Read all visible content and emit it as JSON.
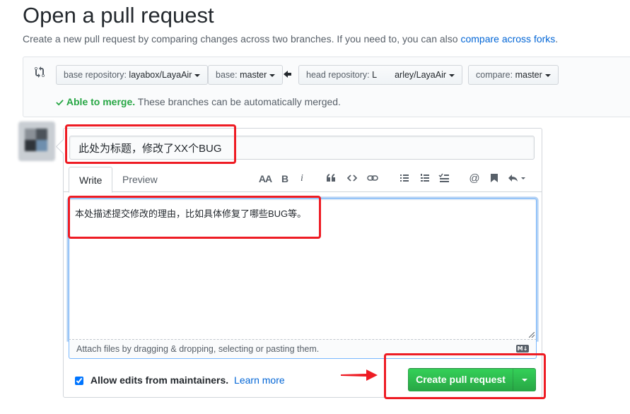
{
  "page": {
    "title": "Open a pull request",
    "subtitle": "Create a new pull request by comparing changes across two branches. If you need to, you can also",
    "subtitle_link": "compare across forks",
    "subtitle_end": "."
  },
  "range": {
    "base_repository": {
      "label": "base repository:",
      "value": "layabox/LayaAir"
    },
    "base": {
      "label": "base:",
      "value": "master"
    },
    "head_repository": {
      "label": "head repository:",
      "value": "L    arley/LayaAir"
    },
    "compare": {
      "label": "compare:",
      "value": "master"
    },
    "merge_status_bold": "Able to merge.",
    "merge_status_text": "These branches can be automatically merged."
  },
  "form": {
    "title_value": "此处为标题，修改了XX个BUG",
    "tabs": [
      {
        "label": "Write"
      },
      {
        "label": "Preview"
      }
    ],
    "toolbar": {
      "header": "AA",
      "bold": "B",
      "italic": "i"
    },
    "body_value": "本处描述提交修改的理由，比如具体修复了哪些BUG等。",
    "attach_text": "Attach files by dragging & dropping, selecting or pasting them.",
    "markdown_badge": "M↓",
    "allow_edits_label": "Allow edits from maintainers.",
    "allow_edits_checked": true,
    "learn_more": "Learn more",
    "create_button": "Create pull request"
  },
  "colors": {
    "annotation": "#ee1c24",
    "primary_button": "#28a745",
    "link": "#0366d6",
    "success": "#28a745"
  },
  "icons": [
    "git-compare-icon",
    "left-arrow-icon",
    "check-icon",
    "text-size-icon",
    "bold-icon",
    "italic-icon",
    "quote-icon",
    "code-icon",
    "link-icon",
    "bulleted-list-icon",
    "numbered-list-icon",
    "task-list-icon",
    "mention-icon",
    "bookmark-icon",
    "reply-icon",
    "markdown-icon",
    "chevron-down-icon"
  ]
}
